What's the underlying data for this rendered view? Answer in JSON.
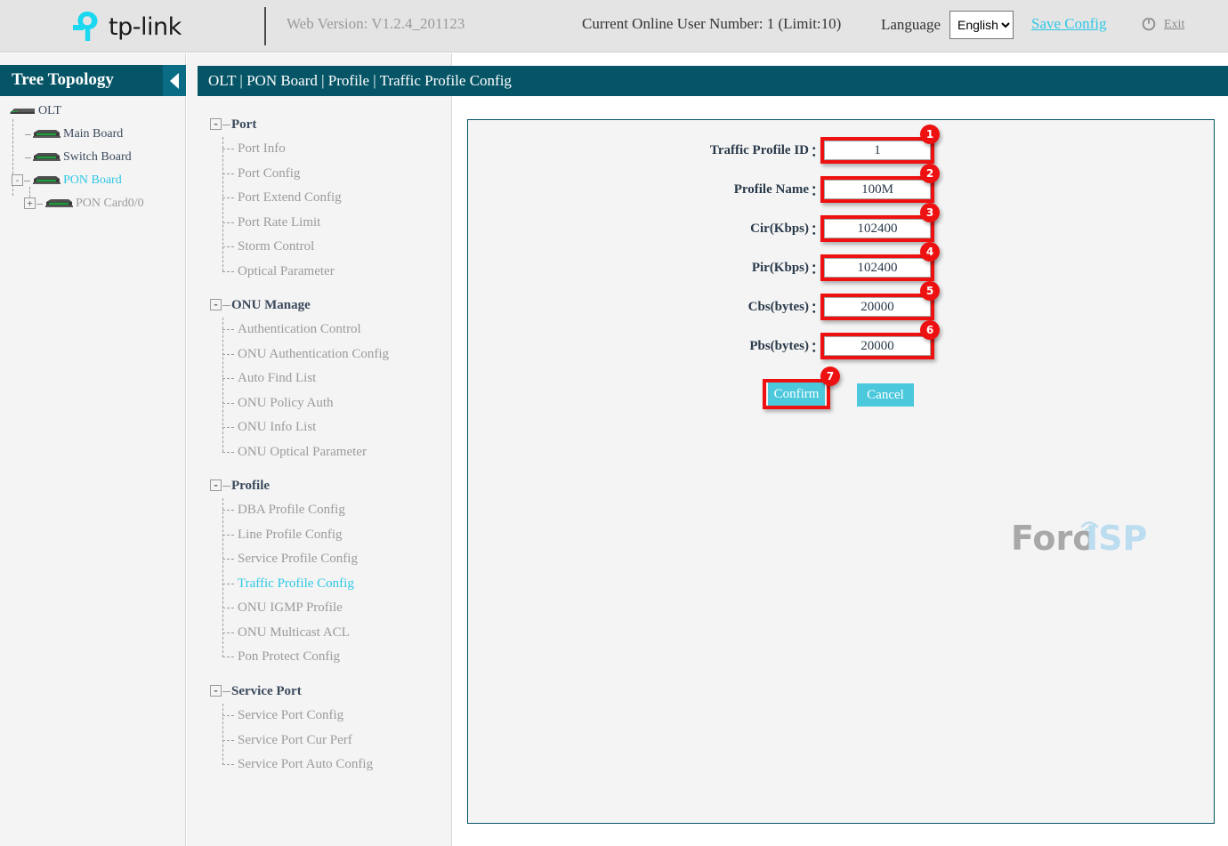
{
  "header": {
    "brand": "tp-link",
    "brand_color": "#1ad8ef",
    "web_version": "Web Version: V1.2.4_201123",
    "online_users": "Current Online User Number: 1 (Limit:10)",
    "language_label": "Language",
    "language_selected": "English",
    "language_options": [
      "English"
    ],
    "save_config": "Save Config",
    "save_config_color": "#2ec8e6",
    "exit": "Exit",
    "power_icon": "power-icon"
  },
  "sidebar": {
    "title": "Tree Topology",
    "collapse_icon": "chevron-left-icon",
    "nodes": [
      {
        "label": "OLT",
        "icon": "device-chassis-icon",
        "color": "dark",
        "expander": null
      },
      {
        "label": "Main Board",
        "icon": "device-chassis-icon",
        "color": "dark",
        "expander": null
      },
      {
        "label": "Switch Board",
        "icon": "device-chassis-icon",
        "color": "dark",
        "expander": null
      },
      {
        "label": "PON Board",
        "icon": "device-chassis-icon",
        "color": "active",
        "expander": "-"
      },
      {
        "label": "PON Card0/0",
        "icon": "device-chassis-icon",
        "color": "dim",
        "expander": "+"
      }
    ]
  },
  "menu": {
    "groups": [
      {
        "label": "Port",
        "expander": "-",
        "items": [
          "Port Info",
          "Port Config",
          "Port Extend Config",
          "Port Rate Limit",
          "Storm Control",
          "Optical Parameter"
        ]
      },
      {
        "label": "ONU Manage",
        "expander": "-",
        "items": [
          "Authentication Control",
          "ONU Authentication Config",
          "Auto Find List",
          "ONU Policy Auth",
          "ONU Info List",
          "ONU Optical Parameter"
        ]
      },
      {
        "label": "Profile",
        "expander": "-",
        "items": [
          "DBA Profile Config",
          "Line Profile Config",
          "Service Profile Config",
          "Traffic Profile Config",
          "ONU IGMP Profile",
          "ONU Multicast ACL",
          "Pon Protect Config"
        ],
        "active_item": "Traffic Profile Config"
      },
      {
        "label": "Service Port",
        "expander": "-",
        "items": [
          "Service Port Config",
          "Service Port Cur Perf",
          "Service Port Auto Config"
        ]
      }
    ]
  },
  "breadcrumb": "OLT | PON Board | Profile | Traffic Profile Config",
  "form": {
    "fields": [
      {
        "label": "Traffic Profile ID",
        "value": "1",
        "badge": "1"
      },
      {
        "label": "Profile Name",
        "value": "100M",
        "badge": "2"
      },
      {
        "label": "Cir(Kbps)",
        "value": "102400",
        "badge": "3"
      },
      {
        "label": "Pir(Kbps)",
        "value": "102400",
        "badge": "4"
      },
      {
        "label": "Cbs(bytes)",
        "value": "20000",
        "badge": "5"
      },
      {
        "label": "Pbs(bytes)",
        "value": "20000",
        "badge": "6"
      }
    ],
    "colon": "：",
    "confirm_label": "Confirm",
    "confirm_badge": "7",
    "cancel_label": "Cancel",
    "button_color": "#4bc8dc",
    "annotation_color": "#ee1111"
  },
  "watermark": {
    "text_primary": "Foro",
    "text_secondary": "ISP",
    "primary_color": "#a8a8a8",
    "secondary_color": "#bcdcf0"
  }
}
